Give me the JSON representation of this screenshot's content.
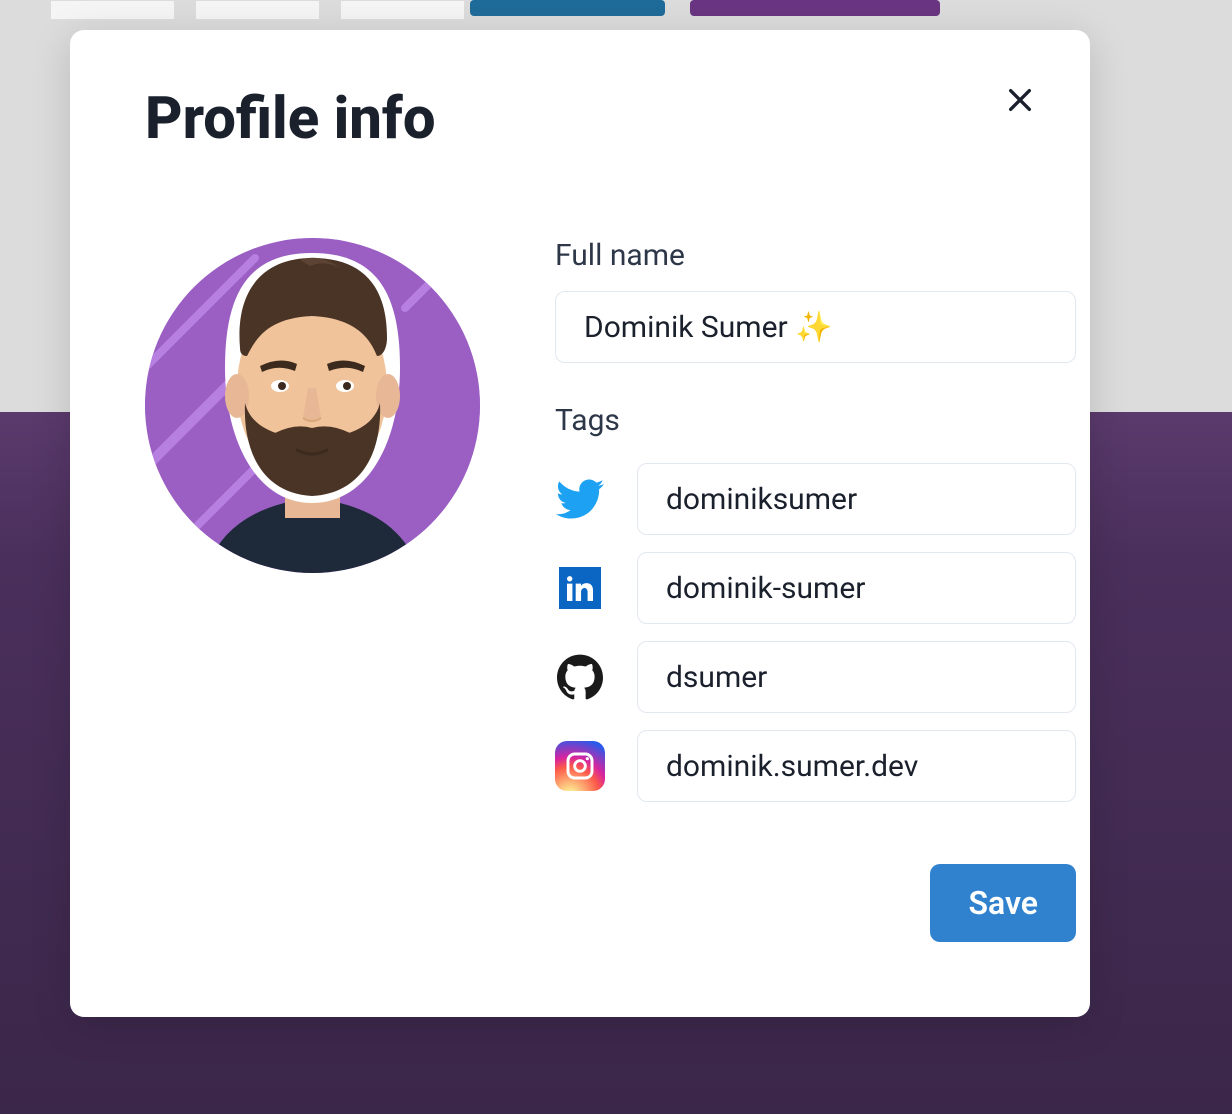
{
  "modal": {
    "title": "Profile info",
    "full_name_label": "Full name",
    "full_name_value": "Dominik Sumer ✨",
    "tags_label": "Tags",
    "tags": {
      "twitter": "dominiksumer",
      "linkedin": "dominik-sumer",
      "github": "dsumer",
      "instagram": "dominik.sumer.dev"
    },
    "save_label": "Save"
  }
}
